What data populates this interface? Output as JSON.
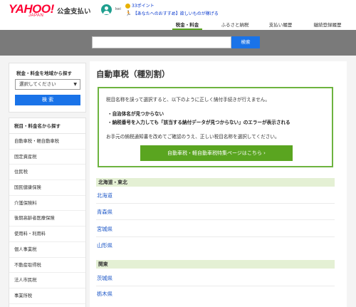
{
  "header": {
    "logo_main": "YAHOO!",
    "logo_sub": "JAPAN",
    "service_name": "公金支払い",
    "username": "kei",
    "points": "33ポイント",
    "promo": "【あなたへのおすすめ】欲しいものが稼げる",
    "tabs": [
      "税金・料金",
      "ふるさと納税",
      "支払い履歴",
      "継続登録履歴"
    ]
  },
  "search": {
    "placeholder": "",
    "button": "検索"
  },
  "sidebar": {
    "region_title": "税金・料金を地域から探す",
    "region_select": "選択してください",
    "region_button": "検 索",
    "list_title": "税目・料金名から探す",
    "items": [
      "自動車税・軽自動車税",
      "固定資産税",
      "住民税",
      "国民健康保険",
      "介護保険料",
      "後期高齢者医療保険",
      "使用料・利用料",
      "個人事業税",
      "不動産取得税",
      "法人市民税",
      "事業所税"
    ]
  },
  "main": {
    "title": "自動車税（種別割）",
    "notice_intro": "税目名称を誤って選択すると、以下のように正しく納付手続きが行えません。",
    "notice_bullet1": "・自治体名が見つからない",
    "notice_bullet2": "・納税番号を入力しても「該当する納付データが見つからない」のエラーが表示される",
    "notice_outro": "お手元の納税通知書を改めてご確認のうえ、正しい税目名称を選択してください。",
    "notice_button": "自動車税・軽自動車税特集ページはこちら ›",
    "regions": [
      {
        "name": "北海道・東北",
        "prefectures": [
          "北海道",
          "青森県",
          "宮城県",
          "山形県"
        ]
      },
      {
        "name": "関東",
        "prefectures": [
          "茨城県",
          "栃木県"
        ]
      }
    ]
  },
  "colors": {
    "brand_red": "#ff0033",
    "accent_green": "#5aa520",
    "link_blue": "#1a55c6",
    "button_blue": "#1a73e8",
    "band_gray": "#7a7a7a"
  }
}
